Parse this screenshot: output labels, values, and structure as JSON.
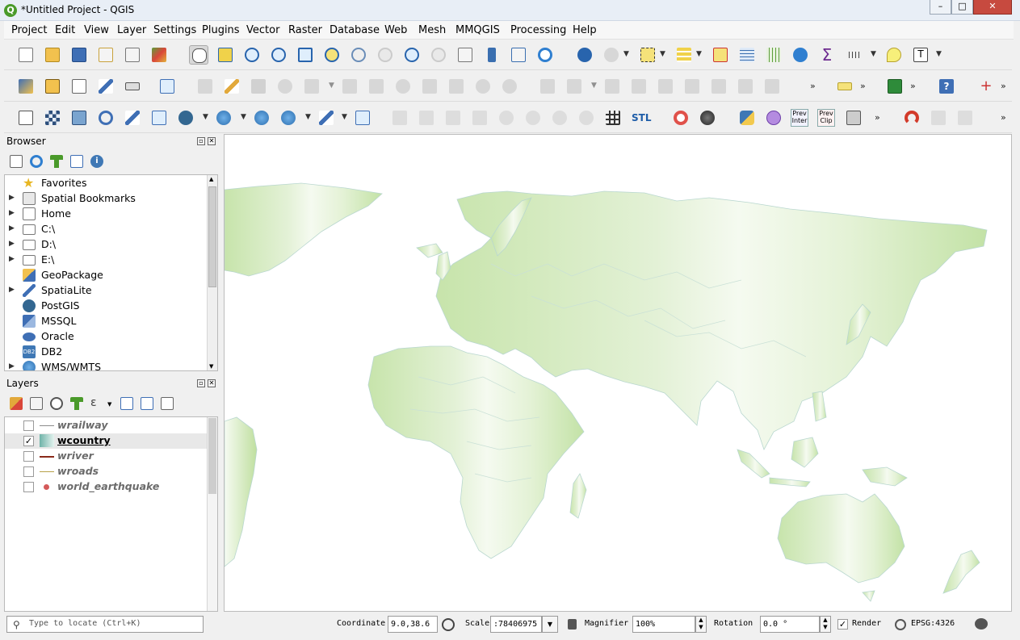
{
  "window": {
    "title": "*Untitled Project - QGIS",
    "logo": "Q",
    "minimize": "–",
    "maximize": "□",
    "close": "✕"
  },
  "menu": [
    "Project",
    "Edit",
    "View",
    "Layer",
    "Settings",
    "Plugins",
    "Vector",
    "Raster",
    "Database",
    "Web",
    "Mesh",
    "MMQGIS",
    "Processing",
    "Help"
  ],
  "toolbar": {
    "stl_label": "STL",
    "prev_inter": "Prev Inter",
    "prev_clip": "Prev Clip",
    "overflow": "»"
  },
  "browser": {
    "title": "Browser",
    "items": [
      {
        "label": "Favorites",
        "icon": "star-icon",
        "expandable": false
      },
      {
        "label": "Spatial Bookmarks",
        "icon": "bookmark-icon",
        "expandable": true
      },
      {
        "label": "Home",
        "icon": "home-folder-icon",
        "expandable": true
      },
      {
        "label": "C:\\",
        "icon": "folder-icon",
        "expandable": true
      },
      {
        "label": "D:\\",
        "icon": "folder-icon",
        "expandable": true
      },
      {
        "label": "E:\\",
        "icon": "folder-icon",
        "expandable": true
      },
      {
        "label": "GeoPackage",
        "icon": "geopackage-icon",
        "expandable": false
      },
      {
        "label": "SpatiaLite",
        "icon": "spatialite-icon",
        "expandable": true
      },
      {
        "label": "PostGIS",
        "icon": "postgis-icon",
        "expandable": false
      },
      {
        "label": "MSSQL",
        "icon": "mssql-icon",
        "expandable": false
      },
      {
        "label": "Oracle",
        "icon": "oracle-icon",
        "expandable": false
      },
      {
        "label": "DB2",
        "icon": "db2-icon",
        "expandable": false
      },
      {
        "label": "WMS/WMTS",
        "icon": "wms-icon",
        "expandable": true
      }
    ]
  },
  "layers": {
    "title": "Layers",
    "items": [
      {
        "label": "wrailway",
        "checked": false,
        "symbol": "line",
        "color": "#8c8c8c"
      },
      {
        "label": "wcountry",
        "checked": true,
        "symbol": "polygon",
        "color": "#9cc9c3"
      },
      {
        "label": "wriver",
        "checked": false,
        "symbol": "arrow-line",
        "color": "#8a2a1a"
      },
      {
        "label": "wroads",
        "checked": false,
        "symbol": "line",
        "color": "#b8a14a"
      },
      {
        "label": "world_earthquake",
        "checked": false,
        "symbol": "point",
        "color": "#d45a5a"
      }
    ]
  },
  "map": {
    "land_color": "#c5e3a8",
    "land_highlight": "#f4faef",
    "border_color": "#b9d7cf"
  },
  "status": {
    "locate_placeholder": "Type to locate (Ctrl+K)",
    "coordinate_label": "Coordinate",
    "coordinate_value": "9.0,38.6",
    "scale_label": "Scale",
    "scale_value": ":78406975",
    "magnifier_label": "Magnifier",
    "magnifier_value": "100%",
    "rotation_label": "Rotation",
    "rotation_value": "0.0 °",
    "render_label": "Render",
    "render_checked": true,
    "crs_label": "EPSG:4326"
  }
}
